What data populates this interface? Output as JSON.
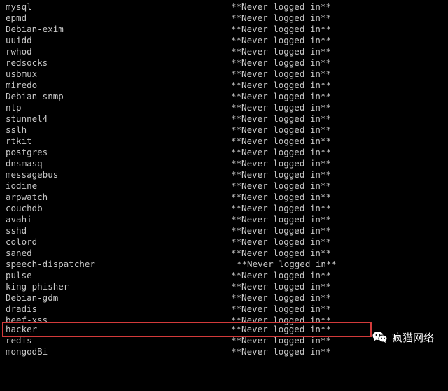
{
  "terminal": {
    "rows": [
      {
        "user": "mysql",
        "status": "**Never logged in**"
      },
      {
        "user": "epmd",
        "status": "**Never logged in**"
      },
      {
        "user": "Debian-exim",
        "status": "**Never logged in**"
      },
      {
        "user": "uuidd",
        "status": "**Never logged in**"
      },
      {
        "user": "rwhod",
        "status": "**Never logged in**"
      },
      {
        "user": "redsocks",
        "status": "**Never logged in**"
      },
      {
        "user": "usbmux",
        "status": "**Never logged in**"
      },
      {
        "user": "miredo",
        "status": "**Never logged in**"
      },
      {
        "user": "Debian-snmp",
        "status": "**Never logged in**"
      },
      {
        "user": "ntp",
        "status": "**Never logged in**"
      },
      {
        "user": "stunnel4",
        "status": "**Never logged in**"
      },
      {
        "user": "sslh",
        "status": "**Never logged in**"
      },
      {
        "user": "rtkit",
        "status": "**Never logged in**"
      },
      {
        "user": "postgres",
        "status": "**Never logged in**"
      },
      {
        "user": "dnsmasq",
        "status": "**Never logged in**"
      },
      {
        "user": "messagebus",
        "status": "**Never logged in**"
      },
      {
        "user": "iodine",
        "status": "**Never logged in**"
      },
      {
        "user": "arpwatch",
        "status": "**Never logged in**"
      },
      {
        "user": "couchdb",
        "status": "**Never logged in**"
      },
      {
        "user": "avahi",
        "status": "**Never logged in**"
      },
      {
        "user": "sshd",
        "status": "**Never logged in**"
      },
      {
        "user": "colord",
        "status": "**Never logged in**"
      },
      {
        "user": "saned",
        "status": "**Never logged in**"
      },
      {
        "user": "speech-dispatcher",
        "status": "**Never logged in**"
      },
      {
        "user": "pulse",
        "status": "**Never logged in**"
      },
      {
        "user": "king-phisher",
        "status": "**Never logged in**"
      },
      {
        "user": "Debian-gdm",
        "status": "**Never logged in**"
      },
      {
        "user": "dradis",
        "status": "**Never logged in**"
      },
      {
        "user": "beef-xss",
        "status": "**Never logged in**"
      },
      {
        "user": "hacker",
        "status": "**Never logged in**"
      },
      {
        "user": "redis",
        "status": "**Never logged in**"
      },
      {
        "user": "mongodBi",
        "status": "**Never logged in**"
      }
    ]
  },
  "highlight": {
    "color": "#d23a3a",
    "row_user": "hacker"
  },
  "watermark": {
    "icon": "wechat-icon",
    "text": "疯猫网络"
  }
}
